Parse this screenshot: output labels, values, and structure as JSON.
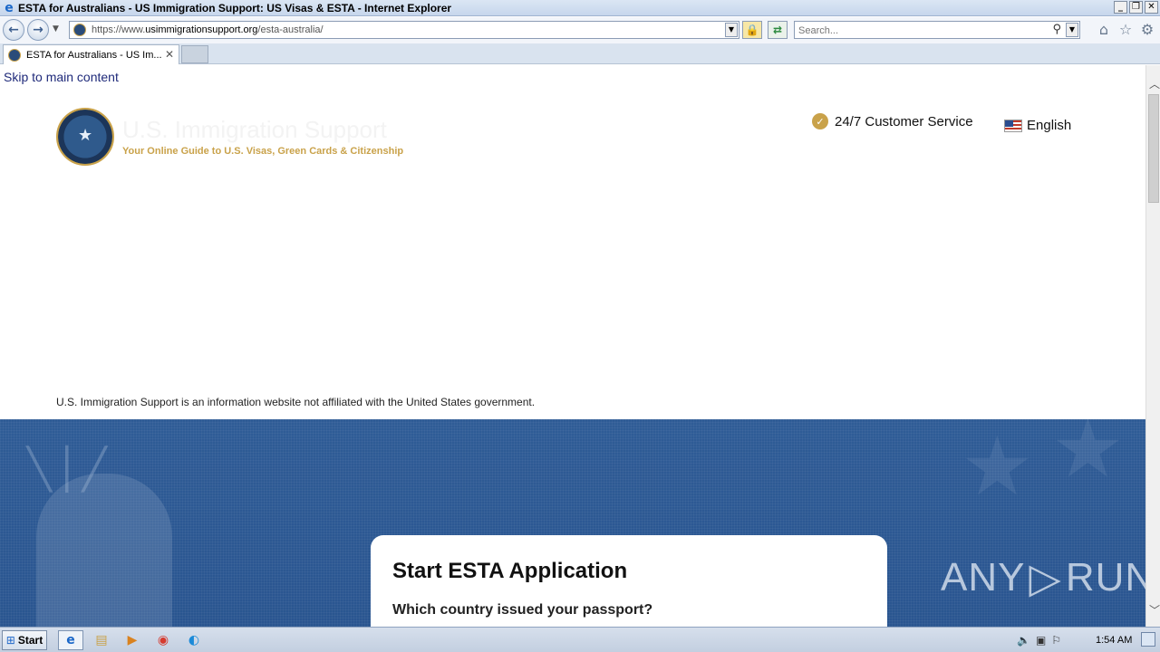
{
  "window": {
    "title": "ESTA for Australians - US Immigration Support: US Visas & ESTA - Internet Explorer",
    "icon": "ie-logo-icon",
    "controls": [
      "minimize",
      "restore",
      "close"
    ]
  },
  "navbar": {
    "url_prefix": "https://www.",
    "url_host": "usimmigrationsupport.org",
    "url_path": "/esta-australia/",
    "search_placeholder": "Search..."
  },
  "tabs": [
    {
      "label": "ESTA for Australians - US Im...",
      "active": true
    }
  ],
  "page": {
    "skip_link": "Skip to main content",
    "brand_title": "U.S. Immigration Support",
    "brand_tagline": "Your Online Guide to U.S. Visas, Green Cards & Citizenship",
    "customer_service": "24/7 Customer Service",
    "language": "English",
    "disclaimer": "U.S. Immigration Support is an information website not affiliated with the United States government.",
    "card_title": "Start ESTA Application",
    "card_question": "Which country issued your passport?",
    "watermark_left": "ANY",
    "watermark_right": "RUN"
  },
  "taskbar": {
    "start_label": "Start",
    "clock": "1:54 AM"
  },
  "colors": {
    "hero_blue": "#2f5c96",
    "gold": "#c9a24a",
    "link_navy": "#1f2a7a"
  }
}
